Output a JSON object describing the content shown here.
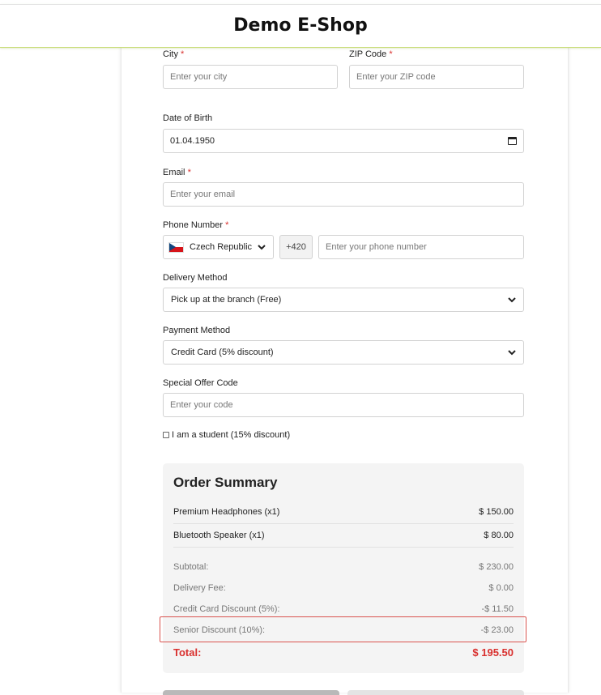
{
  "header": {
    "title": "Demo E-Shop"
  },
  "form": {
    "city": {
      "label": "City",
      "required_mark": "*",
      "placeholder": "Enter your city"
    },
    "zip": {
      "label": "ZIP Code",
      "required_mark": "*",
      "placeholder": "Enter your ZIP code"
    },
    "dob": {
      "label": "Date of Birth",
      "value": "01.04.1950"
    },
    "email": {
      "label": "Email",
      "required_mark": "*",
      "placeholder": "Enter your email"
    },
    "phone": {
      "label": "Phone Number",
      "required_mark": "*",
      "country": "Czech Republic",
      "prefix": "+420",
      "placeholder": "Enter your phone number"
    },
    "delivery": {
      "label": "Delivery Method",
      "value": "Pick up at the branch (Free)"
    },
    "payment": {
      "label": "Payment Method",
      "value": "Credit Card (5% discount)"
    },
    "offer": {
      "label": "Special Offer Code",
      "placeholder": "Enter your code"
    },
    "student": {
      "label": "I am a student (15% discount)",
      "checked": false
    }
  },
  "summary": {
    "title": "Order Summary",
    "items": [
      {
        "name": "Premium Headphones (x1)",
        "price": "$ 150.00"
      },
      {
        "name": "Bluetooth Speaker (x1)",
        "price": "$ 80.00"
      }
    ],
    "lines": [
      {
        "label": "Subtotal:",
        "value": "$ 230.00"
      },
      {
        "label": "Delivery Fee:",
        "value": "$ 0.00"
      },
      {
        "label": "Credit Card Discount (5%):",
        "value": "-$ 11.50"
      },
      {
        "label": "Senior Discount (10%):",
        "value": "-$ 23.00"
      }
    ],
    "total": {
      "label": "Total:",
      "value": "$ 195.50"
    }
  },
  "colors": {
    "required": "#d9302e",
    "total": "#d9302e",
    "highlight_border": "#d9534f",
    "header_border": "#c9dd7a",
    "summary_bg": "#f4f4f4"
  }
}
